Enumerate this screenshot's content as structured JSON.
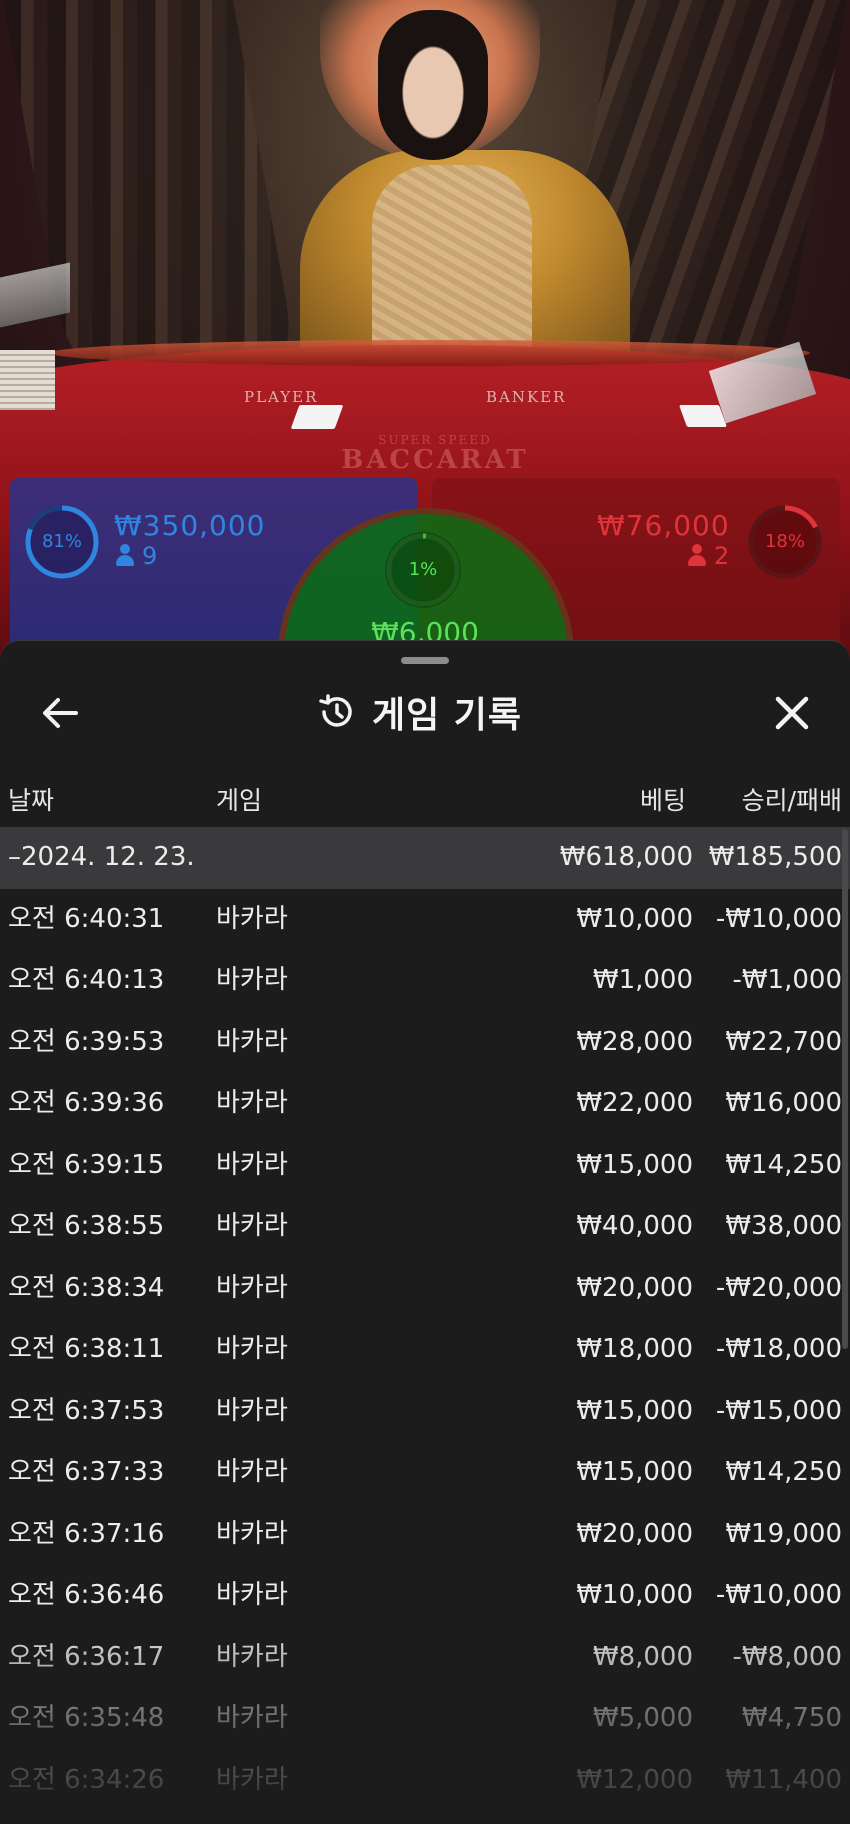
{
  "video": {
    "table_player_label": "PLAYER",
    "table_banker_label": "BANKER",
    "table_logo_top": "SUPER SPEED",
    "table_logo_main": "BACCARAT"
  },
  "bets": {
    "player": {
      "percent": "81%",
      "amount": "₩350,000",
      "players": "9",
      "color": "#2f86e0"
    },
    "banker": {
      "percent": "18%",
      "amount": "₩76,000",
      "players": "2",
      "color": "#e0333a"
    },
    "tie": {
      "percent": "1%",
      "amount": "₩6,000",
      "color": "#38c638"
    }
  },
  "sheet": {
    "title": "게임 기록",
    "icons": {
      "back": "arrow-left-icon",
      "history": "history-icon",
      "close": "close-icon"
    },
    "columns": {
      "date": "날짜",
      "game": "게임",
      "bet": "베팅",
      "result": "승리/패배"
    },
    "summary": {
      "date": "–2024. 12. 23.",
      "bet": "₩618,000",
      "result": "₩185,500"
    },
    "rows": [
      {
        "time": "오전 6:40:31",
        "game": "바카라",
        "bet": "₩10,000",
        "result": "-₩10,000"
      },
      {
        "time": "오전 6:40:13",
        "game": "바카라",
        "bet": "₩1,000",
        "result": "-₩1,000"
      },
      {
        "time": "오전 6:39:53",
        "game": "바카라",
        "bet": "₩28,000",
        "result": "₩22,700"
      },
      {
        "time": "오전 6:39:36",
        "game": "바카라",
        "bet": "₩22,000",
        "result": "₩16,000"
      },
      {
        "time": "오전 6:39:15",
        "game": "바카라",
        "bet": "₩15,000",
        "result": "₩14,250"
      },
      {
        "time": "오전 6:38:55",
        "game": "바카라",
        "bet": "₩40,000",
        "result": "₩38,000"
      },
      {
        "time": "오전 6:38:34",
        "game": "바카라",
        "bet": "₩20,000",
        "result": "-₩20,000"
      },
      {
        "time": "오전 6:38:11",
        "game": "바카라",
        "bet": "₩18,000",
        "result": "-₩18,000"
      },
      {
        "time": "오전 6:37:53",
        "game": "바카라",
        "bet": "₩15,000",
        "result": "-₩15,000"
      },
      {
        "time": "오전 6:37:33",
        "game": "바카라",
        "bet": "₩15,000",
        "result": "₩14,250"
      },
      {
        "time": "오전 6:37:16",
        "game": "바카라",
        "bet": "₩20,000",
        "result": "₩19,000"
      },
      {
        "time": "오전 6:36:46",
        "game": "바카라",
        "bet": "₩10,000",
        "result": "-₩10,000"
      },
      {
        "time": "오전 6:36:17",
        "game": "바카라",
        "bet": "₩8,000",
        "result": "-₩8,000"
      },
      {
        "time": "오전 6:35:48",
        "game": "바카라",
        "bet": "₩5,000",
        "result": "₩4,750"
      },
      {
        "time": "오전 6:34:26",
        "game": "바카라",
        "bet": "₩12,000",
        "result": "₩11,400"
      }
    ]
  }
}
